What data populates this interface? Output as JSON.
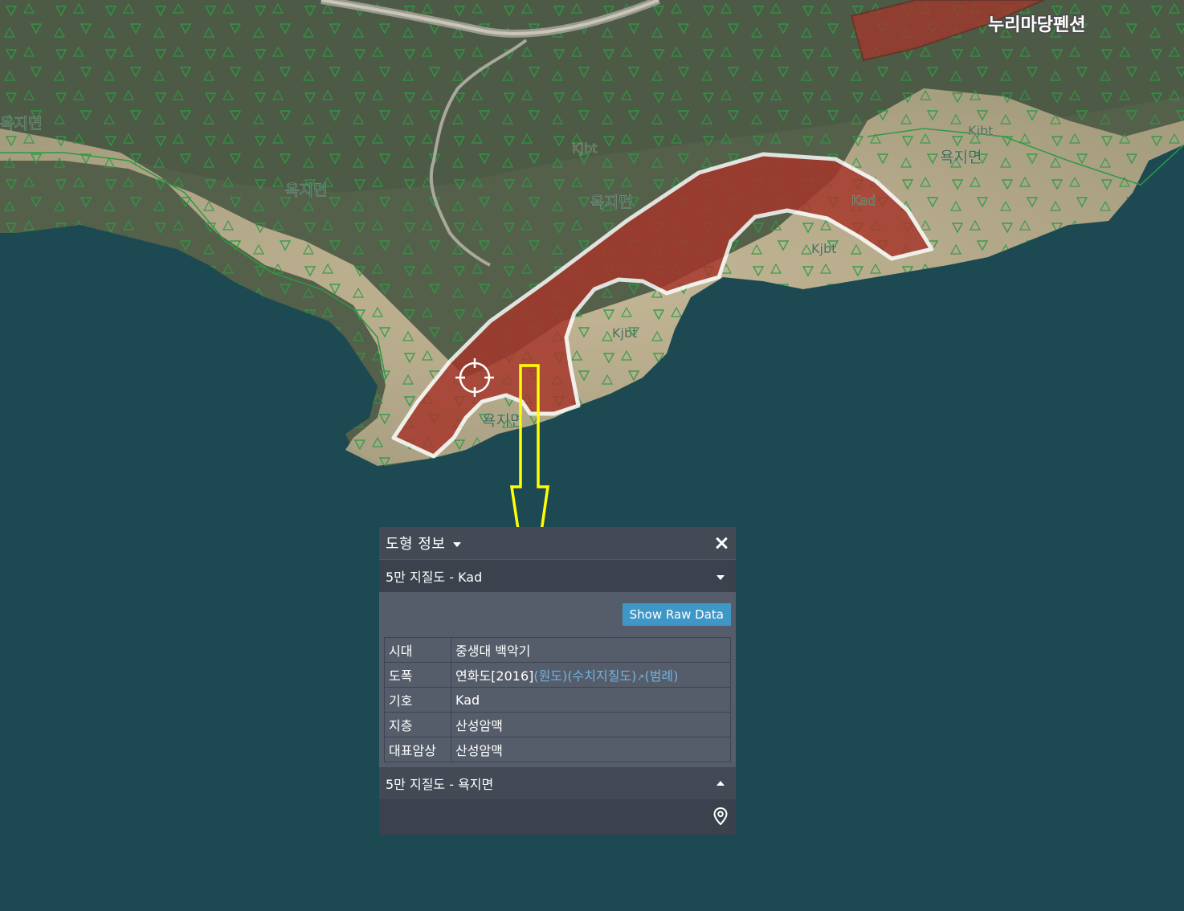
{
  "map": {
    "place_labels": [
      "욕지면",
      "욕지면",
      "욕지면",
      "욕지면",
      "욕지면"
    ],
    "unit_labels": [
      "Kjbt",
      "Kjbt",
      "Kjbt",
      "Kad",
      "Kjbt"
    ],
    "poi_label": "누리마당펜션"
  },
  "panel": {
    "title": "도형 정보",
    "section1": {
      "title": "5만 지질도 - Kad",
      "raw_button": "Show Raw Data",
      "rows": [
        {
          "key": "시대",
          "value": "중생대 백악기"
        },
        {
          "key": "도폭",
          "value": "연화도[2016]",
          "links": [
            "(원도)",
            "(수치지질도)",
            "(범례)"
          ]
        },
        {
          "key": "기호",
          "value": "Kad"
        },
        {
          "key": "지층",
          "value": "산성암맥"
        },
        {
          "key": "대표암상",
          "value": "산성암맥"
        }
      ]
    },
    "section2": {
      "title": "5만 지질도 - 욕지면"
    }
  },
  "colors": {
    "sea": "#1d4a52",
    "panel": "#3b414d",
    "panel_body": "#565d6a",
    "button": "#3e97c6",
    "link": "#6fb3e0",
    "highlight_fill": "#a6352a",
    "arrow": "#ffff00"
  }
}
